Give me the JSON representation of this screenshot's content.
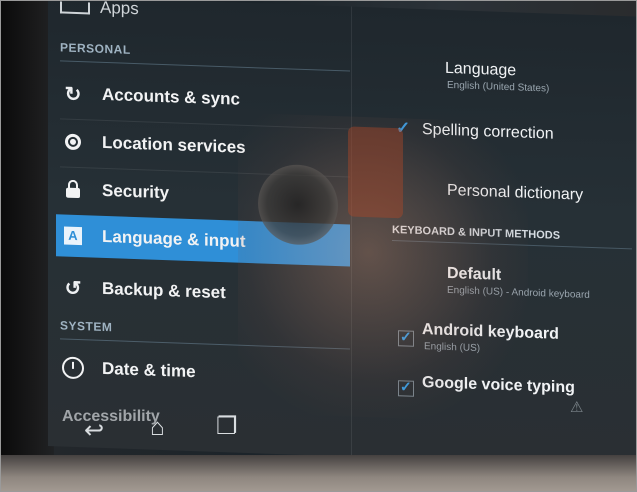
{
  "top_partial": {
    "label": "Apps"
  },
  "personal_section": {
    "title": "PERSONAL"
  },
  "personal_items": [
    {
      "label": "Accounts & sync",
      "icon": "sync-icon"
    },
    {
      "label": "Location services",
      "icon": "location-icon"
    },
    {
      "label": "Security",
      "icon": "lock-icon"
    },
    {
      "label": "Language & input",
      "icon": "language-icon",
      "selected": true
    },
    {
      "label": "Backup & reset",
      "icon": "backup-icon"
    }
  ],
  "system_section": {
    "title": "SYSTEM"
  },
  "system_items": [
    {
      "label": "Date & time",
      "icon": "clock-icon"
    },
    {
      "label": "Accessibility",
      "icon": "accessibility-icon"
    }
  ],
  "language_panel": {
    "language": {
      "title": "Language",
      "subtitle": "English (United States)"
    },
    "spelling_correction": {
      "title": "Spelling correction",
      "checked": true
    },
    "personal_dictionary": {
      "title": "Personal dictionary"
    },
    "keyboard_section": {
      "title": "KEYBOARD & INPUT METHODS"
    },
    "default_input": {
      "title": "Default",
      "subtitle": "English (US) - Android keyboard"
    },
    "android_keyboard": {
      "title": "Android keyboard",
      "subtitle": "English (US)",
      "checked": true
    },
    "google_voice_typing": {
      "title": "Google voice typing",
      "checked": true
    }
  },
  "colors": {
    "selected_bg": "#2f8fd7",
    "accent": "#3aa0e8",
    "section_text": "#9fb3c2"
  },
  "navbar": {
    "back": "back-icon",
    "home": "home-icon",
    "recents": "recents-icon"
  }
}
